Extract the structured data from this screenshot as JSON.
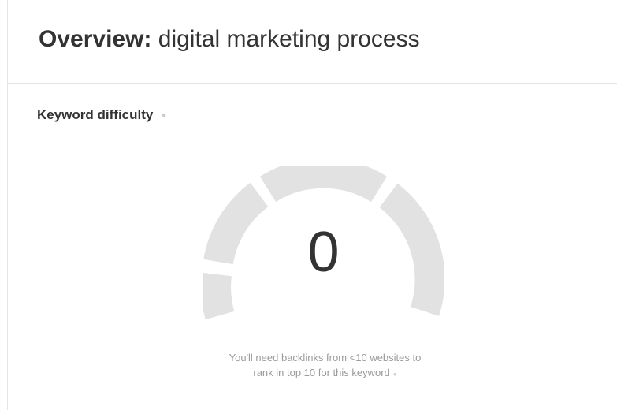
{
  "header": {
    "title_prefix": "Overview:",
    "title_keyword": "digital marketing process"
  },
  "keyword_difficulty": {
    "label": "Keyword difficulty",
    "info_icon": "info-icon",
    "value": "0",
    "caption_line1": "You'll need backlinks from <10 websites to",
    "caption_line2": "rank in top 10 for this keyword",
    "gauge_segment_color": "#e2e2e2"
  }
}
